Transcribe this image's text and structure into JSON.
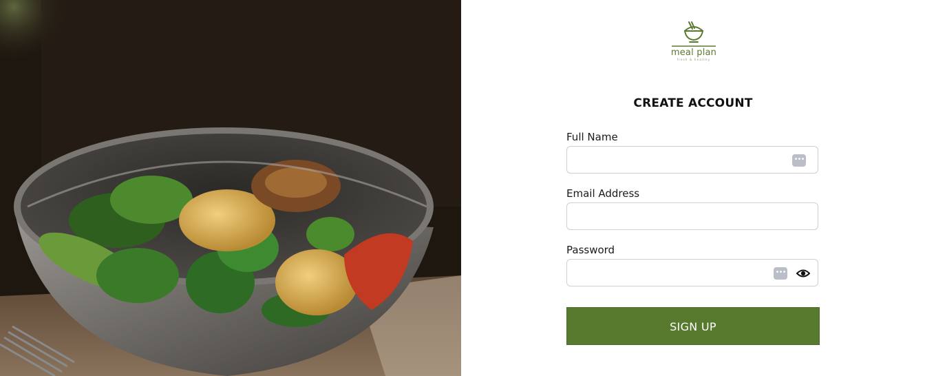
{
  "hero_image": {
    "alt_icon": "salad-bowl-photo"
  },
  "logo": {
    "brand": "meal plan",
    "tagline": "fresh & healthy",
    "icon": "rice-bowl-chopsticks-icon",
    "color": "#587a2e"
  },
  "form": {
    "title": "CREATE ACCOUNT",
    "fields": {
      "full_name": {
        "label": "Full Name",
        "value": "",
        "placeholder": ""
      },
      "email": {
        "label": "Email Address",
        "value": "",
        "placeholder": ""
      },
      "password": {
        "label": "Password",
        "value": "",
        "placeholder": ""
      }
    },
    "password_manager_icon": "password-manager-icon",
    "show_password_icon": "eye-icon",
    "submit_label": "SIGN UP"
  },
  "colors": {
    "accent": "#587a2e",
    "field_border": "#cfcfcf",
    "pm_icon": "#b9bec8"
  }
}
